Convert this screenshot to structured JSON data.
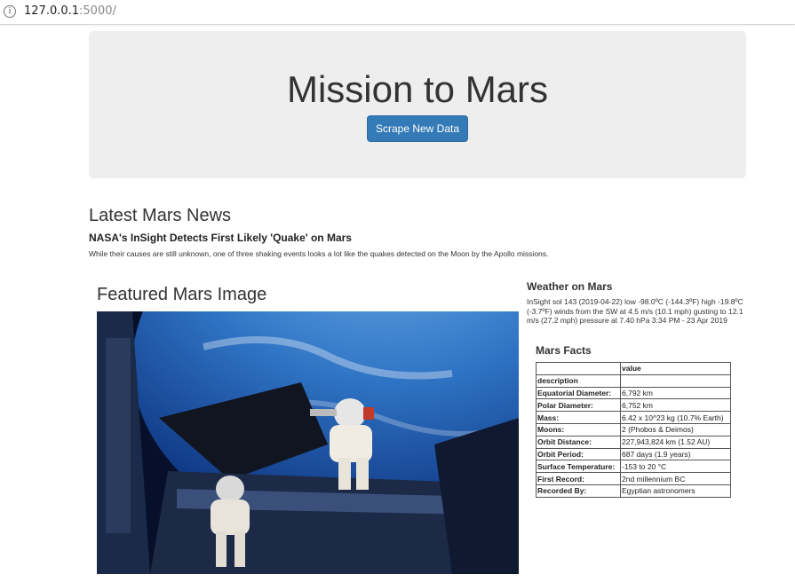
{
  "browser": {
    "url_host": "127.0.0.1",
    "url_rest": ":5000/"
  },
  "jumbotron": {
    "title": "Mission to Mars",
    "scrape_button": "Scrape New Data"
  },
  "news": {
    "heading": "Latest Mars News",
    "title": "NASA's InSight Detects First Likely 'Quake' on Mars",
    "paragraph": "While their causes are still unknown, one of three shaking events looks a lot like the quakes detected on the Moon by the Apollo missions."
  },
  "featured": {
    "heading": "Featured Mars Image"
  },
  "weather": {
    "heading": "Weather on Mars",
    "text": "InSight sol 143 (2019-04-22) low -98.0ºC (-144.3ºF) high -19.8ºC (-3.7ºF) winds from the SW at 4.5 m/s (10.1 mph) gusting to 12.1 m/s (27.2 mph) pressure at 7.40 hPa 3:34 PM - 23 Apr 2019"
  },
  "facts": {
    "heading": "Mars Facts",
    "col_header": "value",
    "index_header": "description",
    "rows": [
      {
        "k": "Equatorial Diameter:",
        "v": "6,792 km"
      },
      {
        "k": "Polar Diameter:",
        "v": "6,752 km"
      },
      {
        "k": "Mass:",
        "v": "6.42 x 10^23 kg (10.7% Earth)"
      },
      {
        "k": "Moons:",
        "v": "2 (Phobos & Deimos)"
      },
      {
        "k": "Orbit Distance:",
        "v": "227,943,824 km (1.52 AU)"
      },
      {
        "k": "Orbit Period:",
        "v": "687 days (1.9 years)"
      },
      {
        "k": "Surface Temperature:",
        "v": "-153 to 20 °C"
      },
      {
        "k": "First Record:",
        "v": "2nd millennium BC"
      },
      {
        "k": "Recorded By:",
        "v": "Egyptian astronomers"
      }
    ]
  }
}
